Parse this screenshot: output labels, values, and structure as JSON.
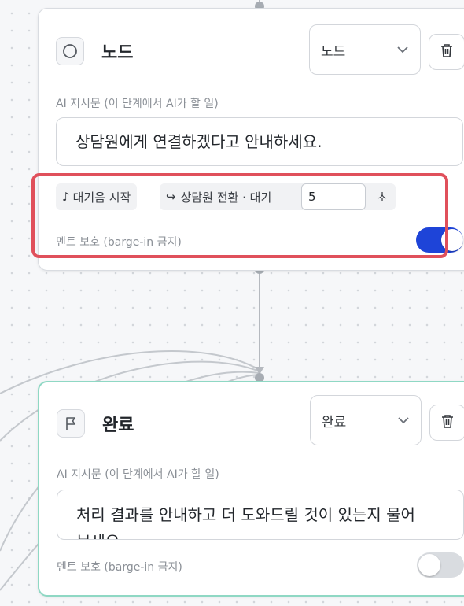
{
  "nodes": [
    {
      "icon": "circle-icon",
      "title": "노드",
      "type_select": "노드",
      "instruction_label": "AI 지시문 (이 단계에서 AI가 할 일)",
      "instruction_text": "상담원에게 연결하겠다고 안내하세요.",
      "hold_music_chip": "대기음 시작",
      "transfer_chip": "상담원 전환 · 대기",
      "wait_seconds": "5",
      "wait_unit": "초",
      "barge_in_label": "멘트 보호 (barge-in 금지)",
      "barge_in_enabled": true
    },
    {
      "icon": "flag-icon",
      "title": "완료",
      "type_select": "완료",
      "instruction_label": "AI 지시문 (이 단계에서 AI가 할 일)",
      "instruction_text": "처리 결과를 안내하고 더 도와드릴 것이 있는지 물어보세요.",
      "barge_in_label": "멘트 보호 (barge-in 금지)",
      "barge_in_enabled": false
    }
  ],
  "colors": {
    "toggle_on": "#1e44d8",
    "highlight": "#e0505b",
    "active_node_border": "#8fd8c4"
  }
}
